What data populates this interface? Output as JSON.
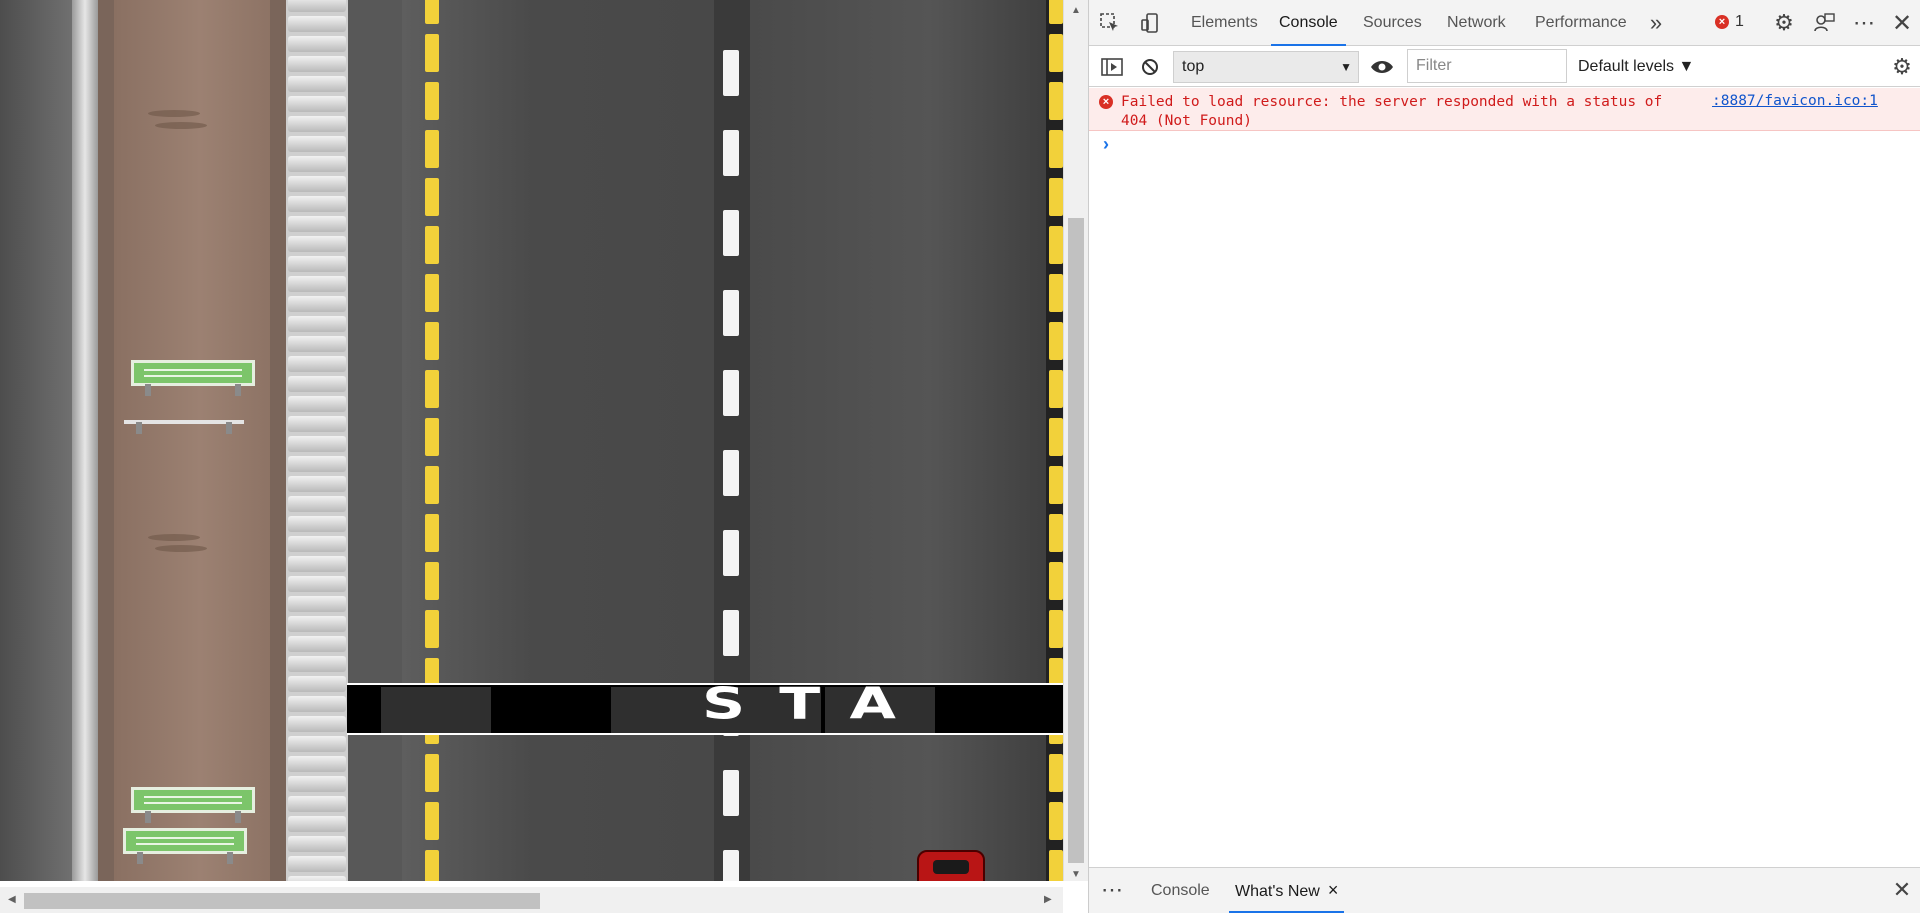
{
  "devtools": {
    "tabs": [
      "Elements",
      "Console",
      "Sources",
      "Network",
      "Performance"
    ],
    "active_tab": "Console",
    "more_tabs_icon": "»",
    "error_count": "1",
    "accent_color": "#1a73e8"
  },
  "console": {
    "context": "top",
    "filter_placeholder": "Filter",
    "levels_label": "Default levels ▼",
    "error_message": "Failed to load resource: the server responded with a status of 404 (Not Found)",
    "error_source": ":8887/favicon.ico:1",
    "error_color": "#d01b1b",
    "prompt_symbol": "›"
  },
  "drawer": {
    "more_label": "⋯",
    "tabs": [
      "Console",
      "What's New"
    ],
    "active_tab": "What's New",
    "tab_close_icon": "×"
  },
  "game": {
    "banner_text": "STA"
  }
}
